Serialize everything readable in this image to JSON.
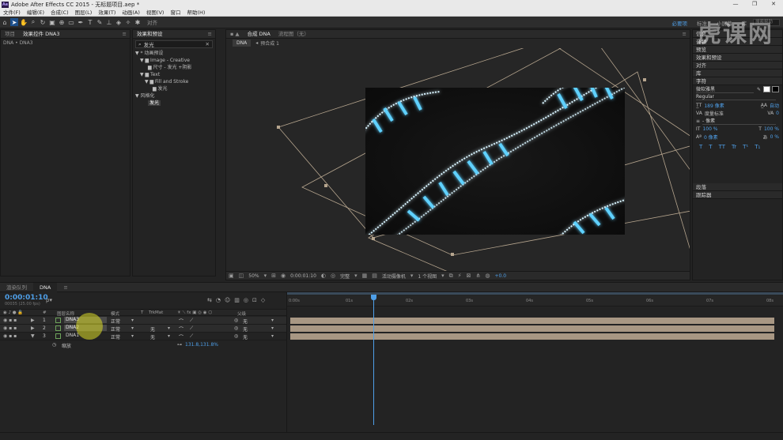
{
  "window": {
    "title": "Adobe After Effects CC 2015 - 无标题项目.aep *",
    "logo": "Ae",
    "minimize": "—",
    "maximize": "❐",
    "close": "✕"
  },
  "menu": [
    "文件(F)",
    "编辑(E)",
    "合成(C)",
    "图层(L)",
    "效果(T)",
    "动画(A)",
    "视图(V)",
    "窗口",
    "帮助(H)"
  ],
  "toolbar": {
    "snap_label": "对齐",
    "workspaces": [
      "必要项",
      "标准",
      "小屏幕",
      "库"
    ],
    "active_workspace": "必要项",
    "help_search": "搜索帮助"
  },
  "project_panel": {
    "tabs": [
      "项目",
      "效果控件 DNA3"
    ],
    "breadcrumb": "DNA • DNA3"
  },
  "effects_panel": {
    "tab": "效果和预设",
    "search_value": "发光",
    "tree": [
      {
        "label": "▼ * 动画预设",
        "indent": 0
      },
      {
        "label": "▼ ▆ Image - Creative",
        "indent": 1
      },
      {
        "label": "▆ 尺寸 - 发光 +阴影",
        "indent": 2
      },
      {
        "label": "▼ ▆ Text",
        "indent": 1
      },
      {
        "label": "▼ ▆ Fill and Stroke",
        "indent": 2
      },
      {
        "label": "▆ 发光",
        "indent": 3
      },
      {
        "label": "▼ 风格化",
        "indent": 0
      },
      {
        "label": "发光",
        "indent": 2,
        "highlight": true
      }
    ]
  },
  "comp_panel": {
    "tabs": [
      "合成 DNA",
      "流程图（无）"
    ],
    "subtabs": [
      "DNA",
      "预合成 1"
    ],
    "bottom": {
      "zoom": "50%",
      "timecode": "0:00:01:10",
      "quality": "完整",
      "camera": "活动摄像机",
      "views": "1 个视图",
      "exposure": "+0.0"
    }
  },
  "right_panel": {
    "sections": [
      "信息",
      "音频",
      "预览",
      "效果和预设",
      "对齐",
      "库"
    ],
    "character": {
      "title": "字符",
      "font": "微软雅黑",
      "style": "Regular",
      "size": "189 像素",
      "leading": "自动",
      "kerning": "度量标准",
      "tracking": "0",
      "stroke_label": "- 像素",
      "vscale": "100 %",
      "hscale": "100 %",
      "baseline": "0 像素",
      "tsume": "0 %",
      "styles": [
        "T",
        "T",
        "TT",
        "Tr",
        "T¹",
        "T₁"
      ]
    },
    "lower_sections": [
      "段落",
      "跟踪器"
    ]
  },
  "timeline": {
    "tabs": [
      "渲染队列",
      "DNA"
    ],
    "timecode": "0:00:01:10",
    "timecode_sub": "00035 (25.00 fps)",
    "search_placeholder": "ρ▾",
    "columns": {
      "num": "#",
      "name": "图层名称",
      "mode": "模式",
      "t": "T",
      "trkmat": "TrkMat",
      "parent": "父级"
    },
    "layers": [
      {
        "num": "1",
        "name": "DNA3",
        "mode": "正常",
        "trkmat": "",
        "parent": "无",
        "selected": true
      },
      {
        "num": "2",
        "name": "DNA2",
        "mode": "正常",
        "trkmat": "无",
        "parent": "无",
        "selected": true
      },
      {
        "num": "3",
        "name": "DNA1",
        "mode": "正常",
        "trkmat": "无",
        "parent": "无",
        "selected": false
      }
    ],
    "sub_property": {
      "label": "缩放",
      "value": "131.8,131.8%"
    },
    "ruler": [
      "0:00s",
      "01s",
      "02s",
      "03s",
      "04s",
      "05s",
      "06s",
      "07s",
      "08s"
    ]
  },
  "colors": {
    "accent": "#4e9fe8",
    "dna_glow": "#5fd1ff",
    "layer_bar": "#a89783",
    "bounding_box": "#b6a58e"
  },
  "watermark": "虎课网"
}
